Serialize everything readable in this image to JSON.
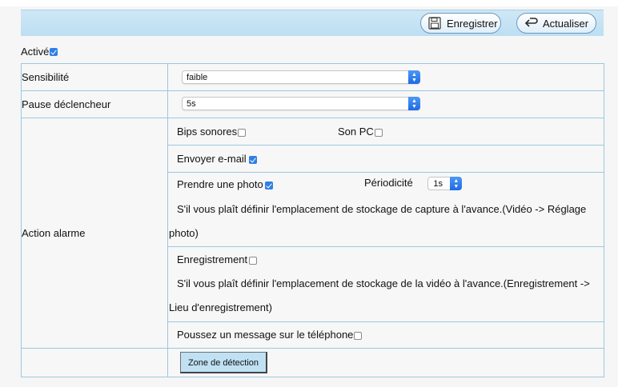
{
  "toolbar": {
    "save_label": "Enregistrer",
    "refresh_label": "Actualiser"
  },
  "active": {
    "label": "Activé",
    "checked": true
  },
  "sensitivity": {
    "label": "Sensibilité",
    "value": "faible"
  },
  "trigger_pause": {
    "label": "Pause déclencheur",
    "value": "5s"
  },
  "alarm_action": {
    "label": "Action alarme",
    "beeps_label": "Bips sonores",
    "beeps_checked": false,
    "pc_sound_label": "Son PC",
    "pc_sound_checked": false,
    "email_label": "Envoyer e-mail",
    "email_checked": true,
    "photo_label": "Prendre une photo",
    "photo_checked": true,
    "periodicity_label": "Périodicité",
    "periodicity_value": "1s",
    "photo_note_line1": "S'il vous plaît définir l'emplacement de stockage de capture à l'avance.(Vidéo -> Réglage",
    "photo_note_line2": "photo)",
    "recording_label": "Enregistrement",
    "recording_checked": false,
    "recording_note_line1": "S'il vous plaît définir l'emplacement de stockage de la vidéo à l'avance.(Enregistrement ->",
    "recording_note_line2": "Lieu d'enregistrement)",
    "push_label": "Poussez un message sur le téléphone",
    "push_checked": false
  },
  "detection_zone": {
    "button_label": "Zone de détection"
  },
  "colors": {
    "toolbar_bg": "#c6e3f4",
    "table_border": "#9cc7e0",
    "checkbox_on": "#2f7fe6",
    "button_bg": "#bfe1f3"
  }
}
